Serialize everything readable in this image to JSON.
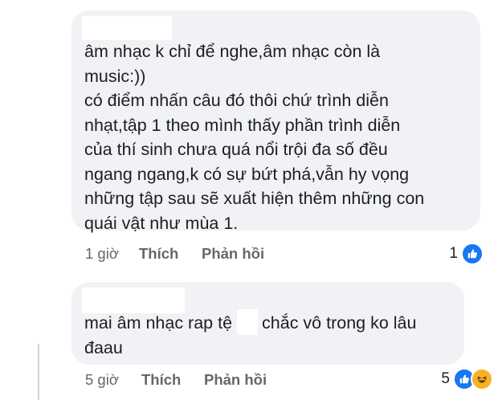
{
  "comments": [
    {
      "text": "âm nhạc k chỉ để nghe,âm nhạc còn là\nmusic:))\ncó điểm nhấn câu đó thôi chứ trình diễn\nnhạt,tập 1 theo mình thấy phần trình diễn\ncủa thí sinh chưa quá nổi trội đa số đều\nngang ngang,k có sự bứt phá,vẫn hy vọng\nnhững tập sau sẽ xuất hiện thêm những con\nquái vật như mùa 1.",
      "time": "1 giờ",
      "like_label": "Thích",
      "reply_label": "Phản hồi",
      "reaction_count": "1",
      "reactions": [
        "like-icon"
      ]
    },
    {
      "text_before": "mai âm nhạc rap tệ",
      "text_after": "chắc vô trong ko lâu\nđaau",
      "time": "5 giờ",
      "like_label": "Thích",
      "reply_label": "Phản hồi",
      "reaction_count": "5",
      "reactions": [
        "like-icon",
        "haha-icon"
      ]
    }
  ],
  "colors": {
    "bubble": "#f0f2f5",
    "text": "#1c1e21",
    "meta": "#65676b",
    "like": "#1877f2",
    "haha": "#f7b125"
  }
}
